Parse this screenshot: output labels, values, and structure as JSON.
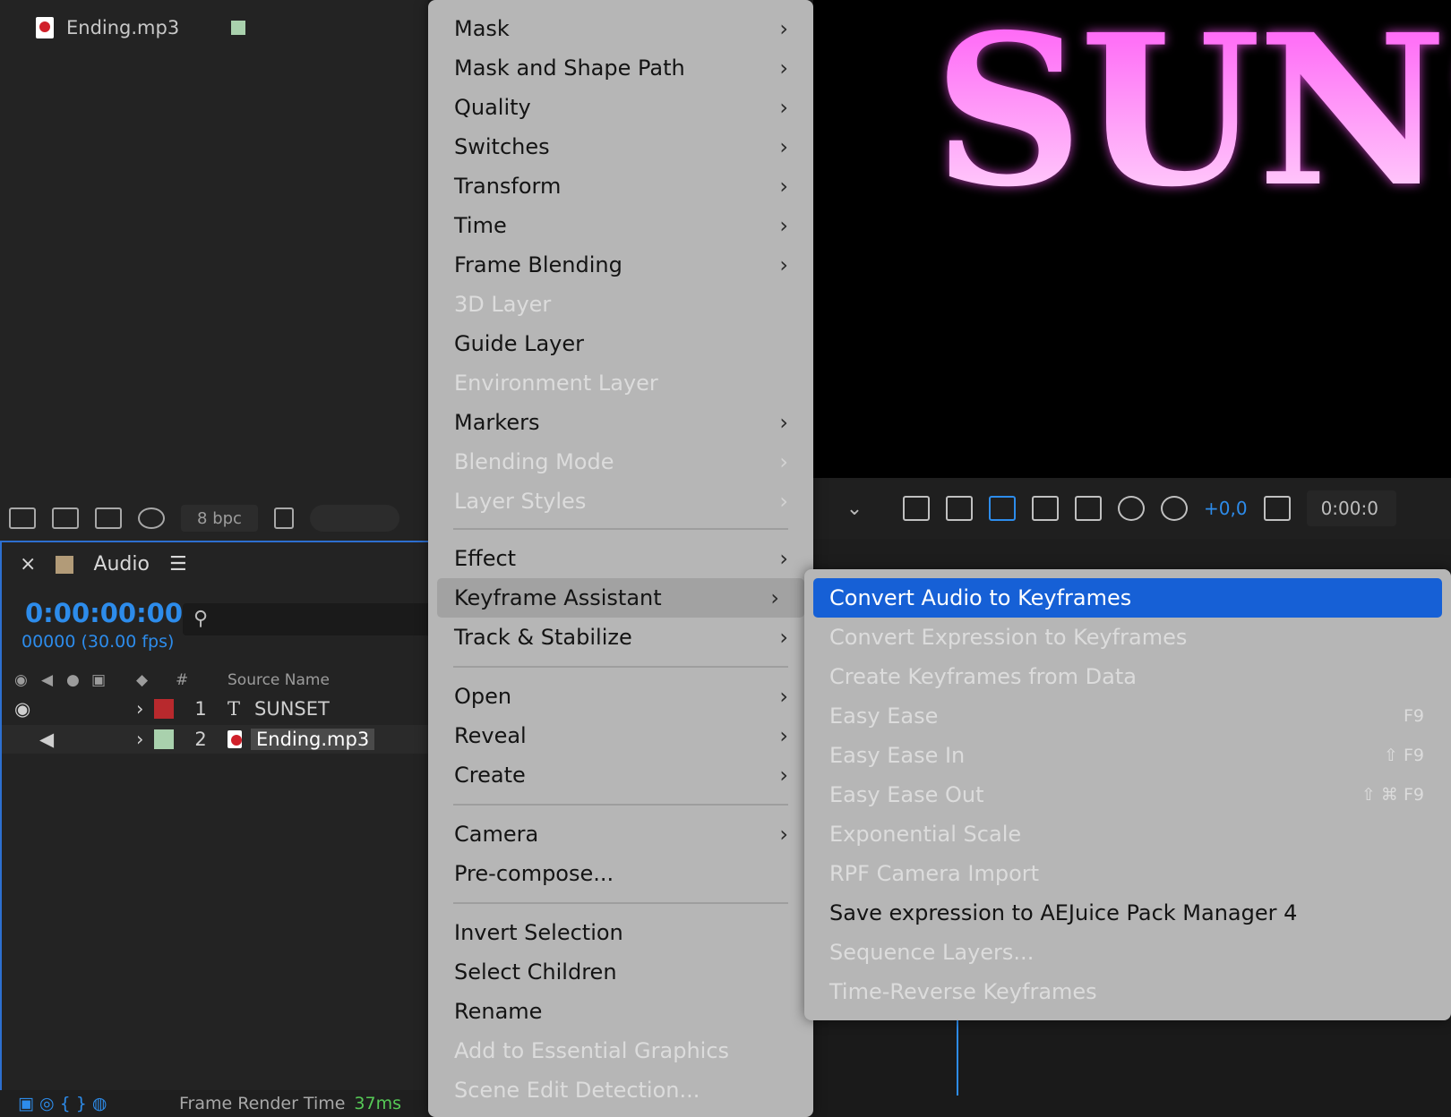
{
  "project": {
    "file_name": "Ending.mp3",
    "bpc": "8 bpc"
  },
  "viewer": {
    "text": "SUNSI",
    "exposure": "+0,0",
    "timecode": "0:00:0"
  },
  "timeline": {
    "comp_name": "Audio",
    "timecode": "0:00:00:00",
    "frames": "00000 (30.00 fps)",
    "headers": {
      "hash": "#",
      "source_name": "Source Name"
    },
    "layers": [
      {
        "num": "1",
        "type_glyph": "T",
        "name": "SUNSET",
        "color": "#b8292d"
      },
      {
        "num": "2",
        "type_glyph": "",
        "name": "Ending.mp3",
        "color": "#a9d1ad"
      }
    ],
    "footer_label": "Frame Render Time",
    "footer_value": "37ms"
  },
  "menu": {
    "items": [
      {
        "label": "Mask",
        "submenu": true,
        "disabled": false
      },
      {
        "label": "Mask and Shape Path",
        "submenu": true,
        "disabled": false
      },
      {
        "label": "Quality",
        "submenu": true,
        "disabled": false
      },
      {
        "label": "Switches",
        "submenu": true,
        "disabled": false
      },
      {
        "label": "Transform",
        "submenu": true,
        "disabled": false
      },
      {
        "label": "Time",
        "submenu": true,
        "disabled": false
      },
      {
        "label": "Frame Blending",
        "submenu": true,
        "disabled": false
      },
      {
        "label": "3D Layer",
        "submenu": false,
        "disabled": true
      },
      {
        "label": "Guide Layer",
        "submenu": false,
        "disabled": false
      },
      {
        "label": "Environment Layer",
        "submenu": false,
        "disabled": true
      },
      {
        "label": "Markers",
        "submenu": true,
        "disabled": false
      },
      {
        "label": "Blending Mode",
        "submenu": true,
        "disabled": true
      },
      {
        "label": "Layer Styles",
        "submenu": true,
        "disabled": true
      },
      {
        "label": "Effect",
        "submenu": true,
        "disabled": false
      },
      {
        "label": "Keyframe Assistant",
        "submenu": true,
        "disabled": false,
        "highlighted": true
      },
      {
        "label": "Track & Stabilize",
        "submenu": true,
        "disabled": false
      },
      {
        "label": "Open",
        "submenu": true,
        "disabled": false
      },
      {
        "label": "Reveal",
        "submenu": true,
        "disabled": false
      },
      {
        "label": "Create",
        "submenu": true,
        "disabled": false
      },
      {
        "label": "Camera",
        "submenu": true,
        "disabled": false
      },
      {
        "label": "Pre-compose...",
        "submenu": false,
        "disabled": false
      },
      {
        "label": "Invert Selection",
        "submenu": false,
        "disabled": false
      },
      {
        "label": "Select Children",
        "submenu": false,
        "disabled": false
      },
      {
        "label": "Rename",
        "submenu": false,
        "disabled": false
      },
      {
        "label": "Add to Essential Graphics",
        "submenu": false,
        "disabled": true
      },
      {
        "label": "Scene Edit Detection...",
        "submenu": false,
        "disabled": true
      }
    ]
  },
  "submenu": {
    "items": [
      {
        "label": "Convert Audio to Keyframes",
        "shortcut": "",
        "disabled": false,
        "selected": true
      },
      {
        "label": "Convert Expression to Keyframes",
        "shortcut": "",
        "disabled": true
      },
      {
        "label": "Create Keyframes from Data",
        "shortcut": "",
        "disabled": true
      },
      {
        "label": "Easy Ease",
        "shortcut": "F9",
        "disabled": true
      },
      {
        "label": "Easy Ease In",
        "shortcut": "⇧ F9",
        "disabled": true
      },
      {
        "label": "Easy Ease Out",
        "shortcut": "⇧ ⌘ F9",
        "disabled": true
      },
      {
        "label": "Exponential Scale",
        "shortcut": "",
        "disabled": true
      },
      {
        "label": "RPF Camera Import",
        "shortcut": "",
        "disabled": true
      },
      {
        "label": "Save expression to AEJuice Pack Manager 4",
        "shortcut": "",
        "disabled": false
      },
      {
        "label": "Sequence Layers...",
        "shortcut": "",
        "disabled": true
      },
      {
        "label": "Time-Reverse Keyframes",
        "shortcut": "",
        "disabled": true
      }
    ]
  }
}
